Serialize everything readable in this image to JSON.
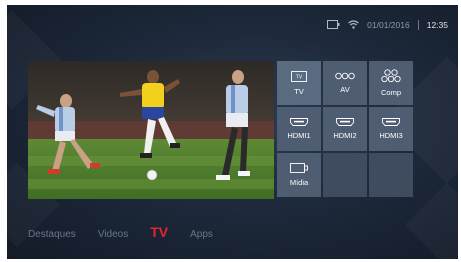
{
  "status": {
    "date": "01/01/2016",
    "time": "12:35",
    "icons": [
      "input-source-icon",
      "wifi-icon"
    ]
  },
  "sources": [
    {
      "label": "TV",
      "icon": "tv-icon"
    },
    {
      "label": "AV",
      "icon": "av-icon"
    },
    {
      "label": "Comp",
      "icon": "component-icon"
    },
    {
      "label": "HDMI1",
      "icon": "hdmi-icon"
    },
    {
      "label": "HDMI2",
      "icon": "hdmi-icon"
    },
    {
      "label": "HDMI3",
      "icon": "hdmi-icon"
    },
    {
      "label": "Mídia",
      "icon": "media-icon"
    },
    {
      "label": "",
      "icon": ""
    },
    {
      "label": "",
      "icon": ""
    }
  ],
  "nav": {
    "items": [
      "Destaques",
      "Videos",
      "TV",
      "Apps"
    ],
    "active": "TV"
  },
  "colors": {
    "accent": "#e8242b",
    "tile": "#4e5d72",
    "background": "#1b2637"
  }
}
